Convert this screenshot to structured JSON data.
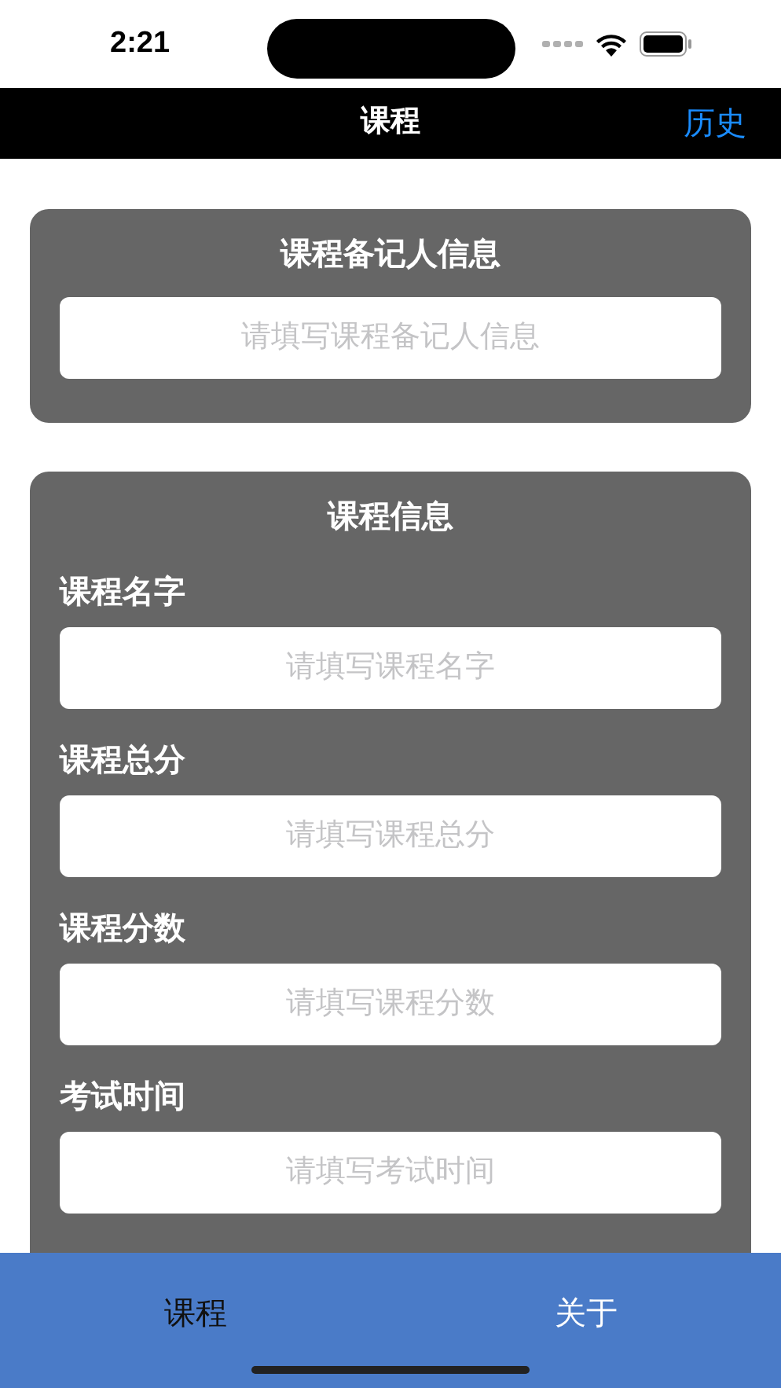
{
  "status_bar": {
    "time": "2:21"
  },
  "nav_bar": {
    "title": "课程",
    "right_button": "历史"
  },
  "recorder_card": {
    "title": "课程备记人信息",
    "field": {
      "placeholder": "请填写课程备记人信息"
    }
  },
  "course_card": {
    "title": "课程信息",
    "fields": [
      {
        "label": "课程名字",
        "placeholder": "请填写课程名字"
      },
      {
        "label": "课程总分",
        "placeholder": "请填写课程总分"
      },
      {
        "label": "课程分数",
        "placeholder": "请填写课程分数"
      },
      {
        "label": "考试时间",
        "placeholder": "请填写考试时间"
      }
    ]
  },
  "tab_bar": [
    {
      "label": "课程",
      "selected": true
    },
    {
      "label": "关于",
      "selected": false
    }
  ]
}
